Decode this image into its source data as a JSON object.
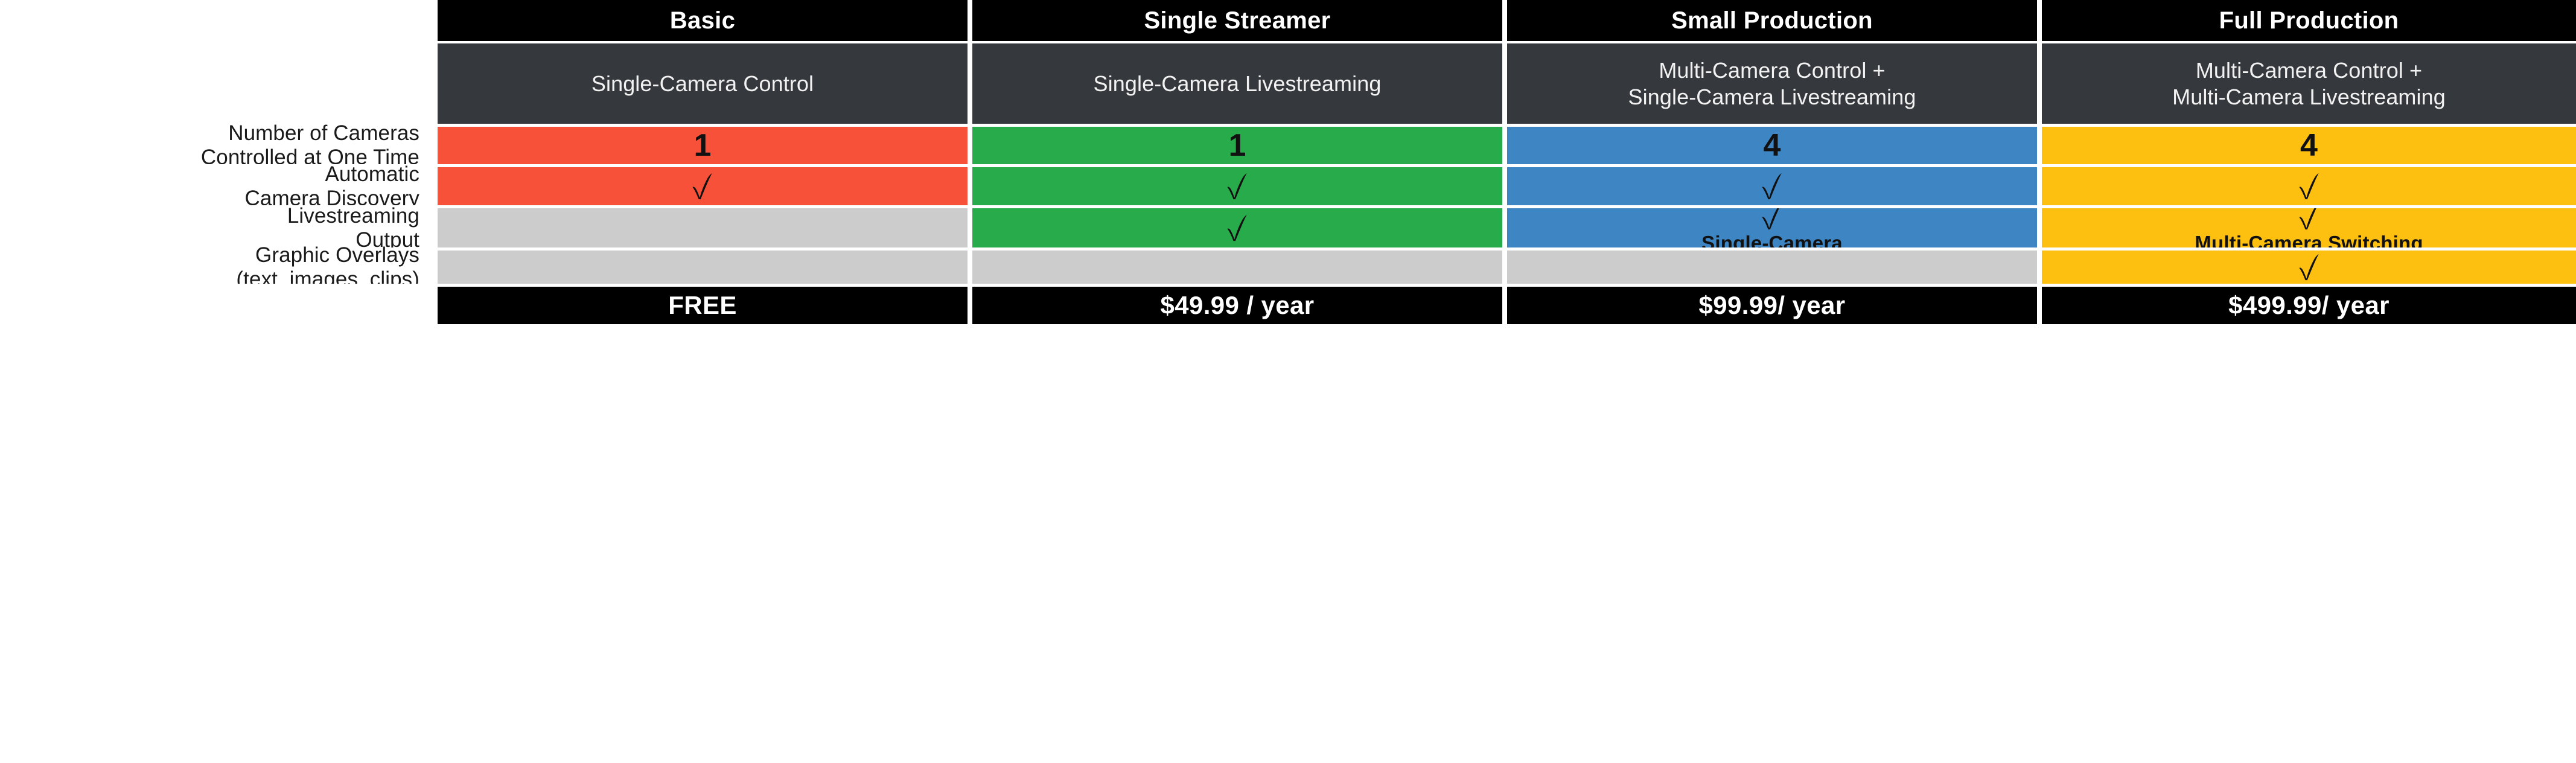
{
  "palette": {
    "basic": "#F75239",
    "single_streamer": "#28AC4B",
    "small_production": "#3E85C3",
    "full_production": "#FDC010",
    "unavailable": "#CCCCCC",
    "header_bg": "#000000",
    "subtitle_bg": "#35383C",
    "page_bg": "#FFFFFF"
  },
  "plans": [
    {
      "name": "Basic",
      "subtitle": "Single-Camera Control"
    },
    {
      "name": "Single Streamer",
      "subtitle": "Single-Camera Livestreaming"
    },
    {
      "name": "Small Production",
      "subtitle": "Multi-Camera Control +\nSingle-Camera Livestreaming"
    },
    {
      "name": "Full Production",
      "subtitle": "Multi-Camera Control +\nMulti-Camera Livestreaming"
    }
  ],
  "features": [
    {
      "label": "Number of Cameras\nControlled at One Time",
      "cells": [
        {
          "kind": "value",
          "value": "1",
          "note": ""
        },
        {
          "kind": "value",
          "value": "1",
          "note": ""
        },
        {
          "kind": "value",
          "value": "4",
          "note": ""
        },
        {
          "kind": "value",
          "value": "4",
          "note": ""
        }
      ]
    },
    {
      "label": "Automatic\nCamera Discovery",
      "cells": [
        {
          "kind": "check",
          "value": "",
          "note": ""
        },
        {
          "kind": "check",
          "value": "",
          "note": ""
        },
        {
          "kind": "check",
          "value": "",
          "note": ""
        },
        {
          "kind": "check",
          "value": "",
          "note": ""
        }
      ]
    },
    {
      "label": "Livestreaming\nOutput",
      "cells": [
        {
          "kind": "none",
          "value": "",
          "note": ""
        },
        {
          "kind": "check",
          "value": "",
          "note": ""
        },
        {
          "kind": "check",
          "value": "",
          "note": "Single-Camera"
        },
        {
          "kind": "check",
          "value": "",
          "note": "Multi-Camera Switching"
        }
      ]
    },
    {
      "label": "Graphic Overlays\n(text, images, clips)",
      "cells": [
        {
          "kind": "none",
          "value": "",
          "note": ""
        },
        {
          "kind": "none",
          "value": "",
          "note": ""
        },
        {
          "kind": "none",
          "value": "",
          "note": ""
        },
        {
          "kind": "check",
          "value": "",
          "note": ""
        }
      ]
    }
  ],
  "pricing": {
    "label": "",
    "values": [
      "FREE",
      "$49.99 / year",
      "$99.99/ year",
      "$499.99/ year"
    ]
  },
  "icons": {
    "check": "check-icon"
  }
}
